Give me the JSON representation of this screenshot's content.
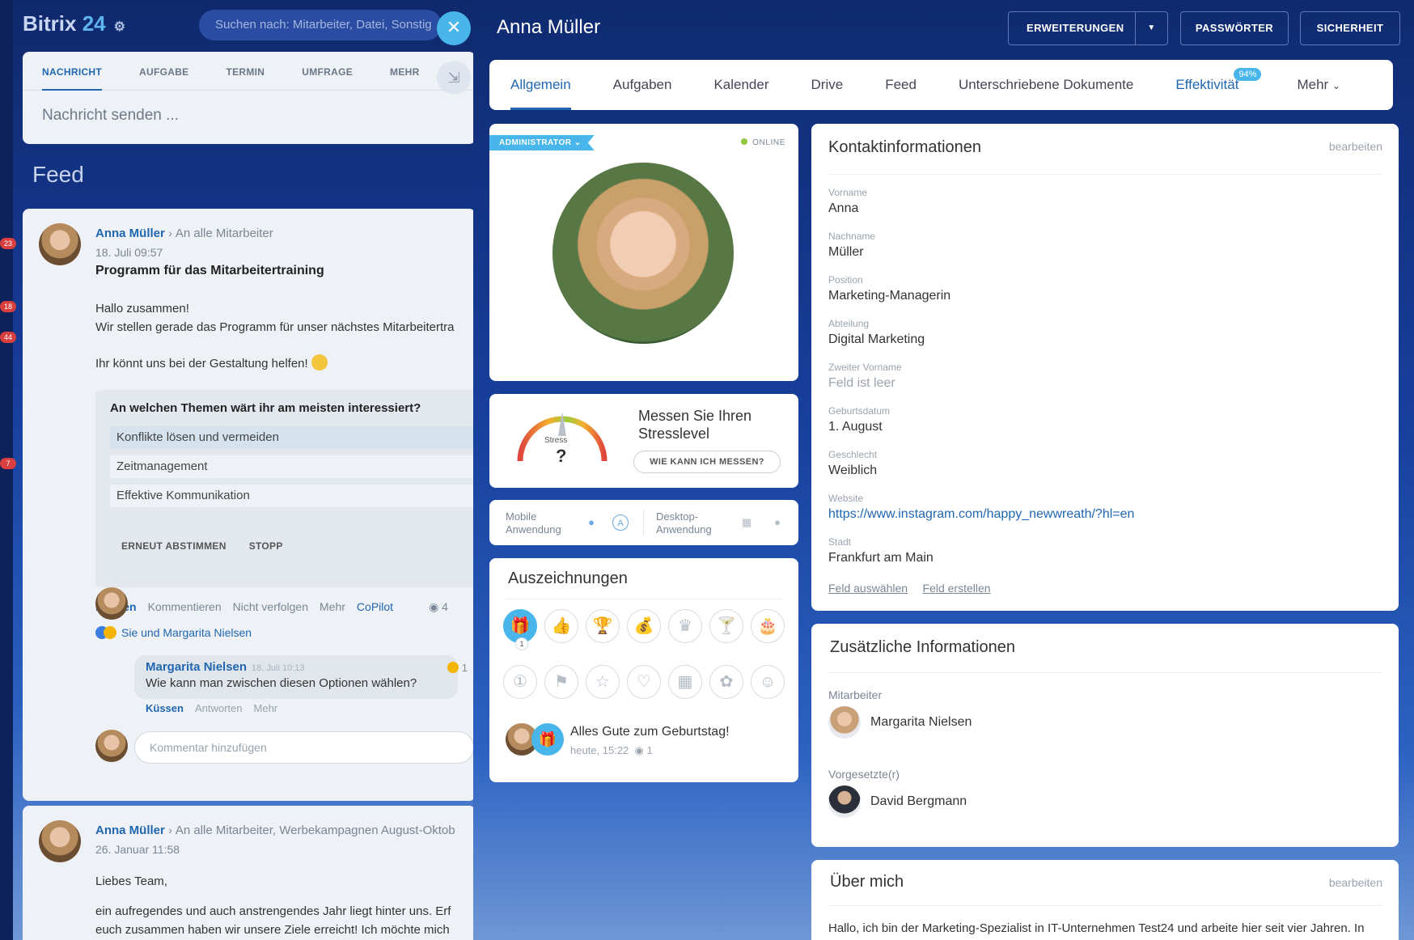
{
  "app": {
    "brand": "Bitrix",
    "brand_num": "24"
  },
  "search": {
    "placeholder": "Suchen nach: Mitarbeiter, Datei, Sonstig"
  },
  "rail_badges": [
    "23",
    "18",
    "44",
    "7"
  ],
  "composer": {
    "tabs": [
      "NACHRICHT",
      "AUFGABE",
      "TERMIN",
      "UMFRAGE",
      "MEHR"
    ],
    "input_placeholder": "Nachricht senden ..."
  },
  "feed": {
    "title": "Feed",
    "post1": {
      "author": "Anna Müller",
      "recipients": "An alle Mitarbeiter",
      "date": "18. Juli 09:57",
      "title": "Programm für das Mitarbeitertraining",
      "line1": "Hallo zusammen!",
      "line2": "Wir stellen gerade das Programm für unser nächstes Mitarbeitertra",
      "line3": "Ihr könnt uns bei der Gestaltung helfen!",
      "poll_question": "An welchen Themen wärt ihr am meisten interessiert?",
      "poll_options": [
        "Konflikte lösen und vermeiden",
        "Zeitmanagement",
        "Effektive Kommunikation"
      ],
      "poll_revote": "ERNEUT ABSTIMMEN",
      "poll_stop": "STOPP",
      "actions": {
        "kissen": "Küssen",
        "kommentieren": "Kommentieren",
        "unfollow": "Nicht verfolgen",
        "mehr": "Mehr",
        "copilot": "CoPilot",
        "views": "4"
      },
      "likes_text": "Sie und Margarita Nielsen",
      "comment": {
        "author": "Margarita Nielsen",
        "date": "18. Juli 10:13",
        "text": "Wie kann man zwischen diesen Optionen wählen?",
        "reactions": "1",
        "kissen": "Küssen",
        "antworten": "Antworten",
        "mehr": "Mehr"
      },
      "add_comment_placeholder": "Kommentar hinzufügen"
    },
    "post2": {
      "author": "Anna Müller",
      "recipients": "An alle Mitarbeiter, Werbekampagnen August-Oktob",
      "date": "26. Januar 11:58",
      "line1": "Liebes Team,",
      "line2": "ein aufregendes und auch anstrengendes Jahr liegt hinter uns. Erf",
      "line3": "euch zusammen haben wir unsere Ziele erreicht! Ich möchte mich"
    }
  },
  "profile": {
    "name": "Anna Müller",
    "buttons": {
      "extensions": "ERWEITERUNGEN",
      "passwords": "PASSWÖRTER",
      "security": "SICHERHEIT"
    },
    "tabs": [
      "Allgemein",
      "Aufgaben",
      "Kalender",
      "Drive",
      "Feed",
      "Unterschriebene Dokumente",
      "Effektivität",
      "Mehr"
    ],
    "effectiveness_badge": "94%",
    "role_badge": "ADMINISTRATOR",
    "status": "ONLINE",
    "stress": {
      "gauge_label": "Stress",
      "value": "?",
      "title": "Messen Sie Ihren Stresslevel",
      "button": "WIE KANN ICH MESSEN?"
    },
    "apps": {
      "mobile": "Mobile Anwendung",
      "desktop": "Desktop-Anwendung"
    },
    "awards": {
      "title": "Auszeichnungen",
      "icons_row1": [
        "gift-icon",
        "thumbs-up-icon",
        "trophy-icon",
        "money-bag-icon",
        "crown-icon",
        "cocktail-icon",
        "cake-icon"
      ],
      "icons_row2": [
        "number-one-icon",
        "flag-icon",
        "star-icon",
        "heart-icon",
        "calendar-icon",
        "flower-icon",
        "smile-icon"
      ],
      "gift_count": "1",
      "latest_text": "Alles Gute zum Geburtstag!",
      "latest_date": "heute, 15:22",
      "latest_views": "1"
    },
    "contact": {
      "title": "Kontaktinformationen",
      "edit": "bearbeiten",
      "fields": [
        {
          "label": "Vorname",
          "value": "Anna"
        },
        {
          "label": "Nachname",
          "value": "Müller"
        },
        {
          "label": "Position",
          "value": "Marketing-Managerin"
        },
        {
          "label": "Abteilung",
          "value": "Digital Marketing"
        },
        {
          "label": "Zweiter Vorname",
          "value": "Feld ist leer"
        },
        {
          "label": "Geburtsdatum",
          "value": "1. August"
        },
        {
          "label": "Geschlecht",
          "value": "Weiblich"
        },
        {
          "label": "Website",
          "value": "https://www.instagram.com/happy_newwreath/?hl=en"
        },
        {
          "label": "Stadt",
          "value": "Frankfurt am Main"
        }
      ],
      "select_field": "Feld auswählen",
      "create_field": "Feld erstellen"
    },
    "additional": {
      "title": "Zusätzliche Informationen",
      "employees_label": "Mitarbeiter",
      "employee": "Margarita Nielsen",
      "supervisor_label": "Vorgesetzte(r)",
      "supervisor": "David Bergmann"
    },
    "about": {
      "title": "Über mich",
      "edit": "bearbeiten",
      "text": "Hallo, ich bin der Marketing-Spezialist in IT-Unternehmen Test24 und arbeite hier seit vier Jahren. In"
    }
  },
  "colors": {
    "accent": "#2067b0",
    "badge": "#48b6ea",
    "online": "#8dc63f",
    "background": "#12307d"
  }
}
